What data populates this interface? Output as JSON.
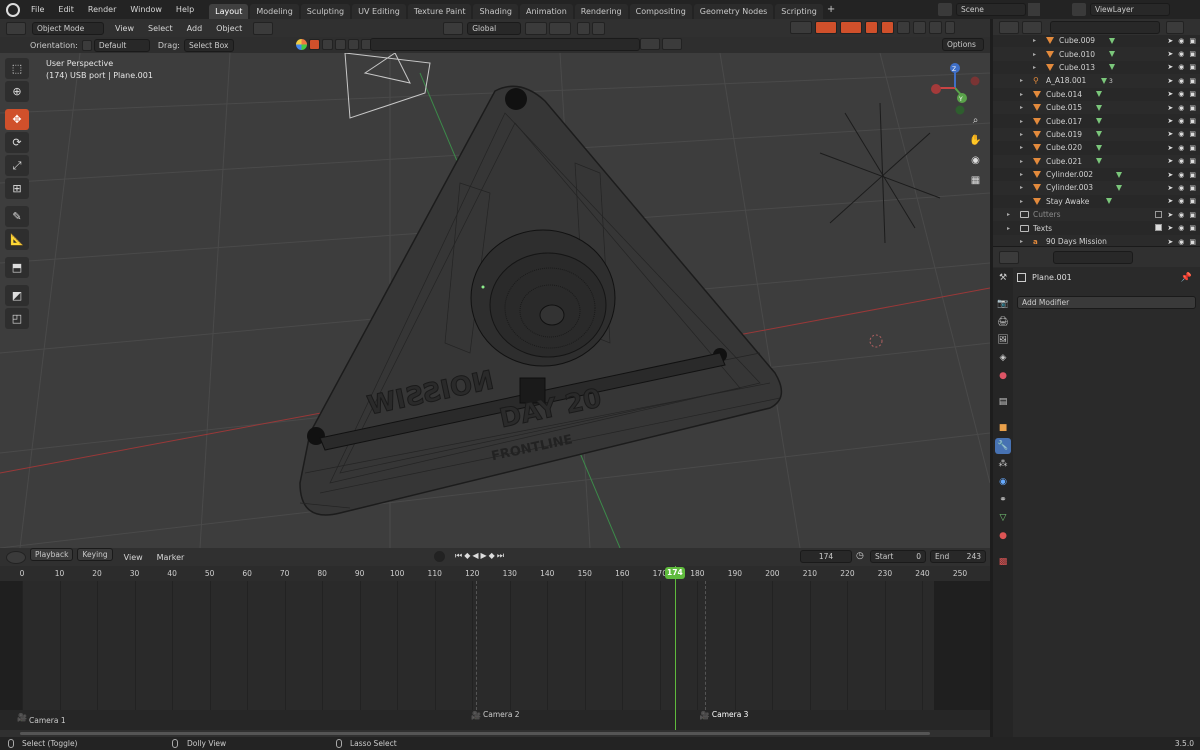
{
  "topbar": {
    "menus": [
      "File",
      "Edit",
      "Render",
      "Window",
      "Help"
    ],
    "workspaces": [
      "Layout",
      "Modeling",
      "Sculpting",
      "UV Editing",
      "Texture Paint",
      "Shading",
      "Animation",
      "Rendering",
      "Compositing",
      "Geometry Nodes",
      "Scripting"
    ],
    "active_workspace": "Layout",
    "add_tab": "+",
    "scene": "Scene",
    "view_layer": "ViewLayer"
  },
  "viewport_header": {
    "mode": "Object Mode",
    "menus": [
      "View",
      "Select",
      "Add",
      "Object"
    ],
    "transform_orientation": "Global",
    "options": "Options"
  },
  "tool_settings": {
    "orientation_label": "Orientation:",
    "orientation_value": "Default",
    "drag_label": "Drag:",
    "drag_value": "Select Box"
  },
  "viewport": {
    "perspective": "User Perspective",
    "context": "(174) USB port | Plane.001",
    "mesh_text_1": "NOISSIW",
    "mesh_text_2": "DAY 20",
    "mesh_text_3": "FRONTLINE",
    "gizmo_z": "Z",
    "gizmo_y": "Y"
  },
  "outliner": {
    "rows": [
      {
        "name": "Cube.009",
        "indent": 2,
        "type": "mesh"
      },
      {
        "name": "Cube.010",
        "indent": 2,
        "type": "mesh"
      },
      {
        "name": "Cube.013",
        "indent": 2,
        "type": "mesh"
      },
      {
        "name": "A_A18.001",
        "indent": 1,
        "type": "armature",
        "badge": "3"
      },
      {
        "name": "Cube.014",
        "indent": 1,
        "type": "mesh"
      },
      {
        "name": "Cube.015",
        "indent": 1,
        "type": "mesh"
      },
      {
        "name": "Cube.017",
        "indent": 1,
        "type": "mesh"
      },
      {
        "name": "Cube.019",
        "indent": 1,
        "type": "mesh"
      },
      {
        "name": "Cube.020",
        "indent": 1,
        "type": "mesh"
      },
      {
        "name": "Cube.021",
        "indent": 1,
        "type": "mesh"
      },
      {
        "name": "Cylinder.002",
        "indent": 1,
        "type": "mesh"
      },
      {
        "name": "Cylinder.003",
        "indent": 1,
        "type": "mesh"
      },
      {
        "name": "Stay Awake",
        "indent": 1,
        "type": "mesh"
      },
      {
        "name": "Cutters",
        "indent": 0,
        "type": "collection"
      },
      {
        "name": "Texts",
        "indent": 0,
        "type": "collection"
      },
      {
        "name": "90 Days Mission",
        "indent": 1,
        "type": "text"
      }
    ]
  },
  "properties": {
    "object_name": "Plane.001",
    "add_modifier": "Add Modifier"
  },
  "timeline": {
    "menus": [
      "Playback",
      "Keying",
      "View",
      "Marker"
    ],
    "current_frame": "174",
    "start_label": "Start",
    "start_value": "0",
    "end_label": "End",
    "end_value": "243",
    "ticks": [
      0,
      10,
      20,
      30,
      40,
      50,
      60,
      70,
      80,
      90,
      100,
      110,
      120,
      130,
      140,
      150,
      160,
      170,
      180,
      190,
      200,
      210,
      220,
      230,
      240,
      250
    ],
    "frame_min": 0,
    "frame_max": 250,
    "markers": [
      {
        "label": "Camera 1",
        "frame": 0
      },
      {
        "label": "Camera 2",
        "frame": 121
      },
      {
        "label": "Camera 3",
        "frame": 182
      }
    ]
  },
  "statusbar": {
    "select": "Select (Toggle)",
    "dolly": "Dolly View",
    "lasso": "Lasso Select",
    "version": "3.5.0"
  },
  "colors": {
    "accent_orange": "#d0502b",
    "playhead_green": "#5fba3d",
    "active_blue": "#4772b3"
  }
}
